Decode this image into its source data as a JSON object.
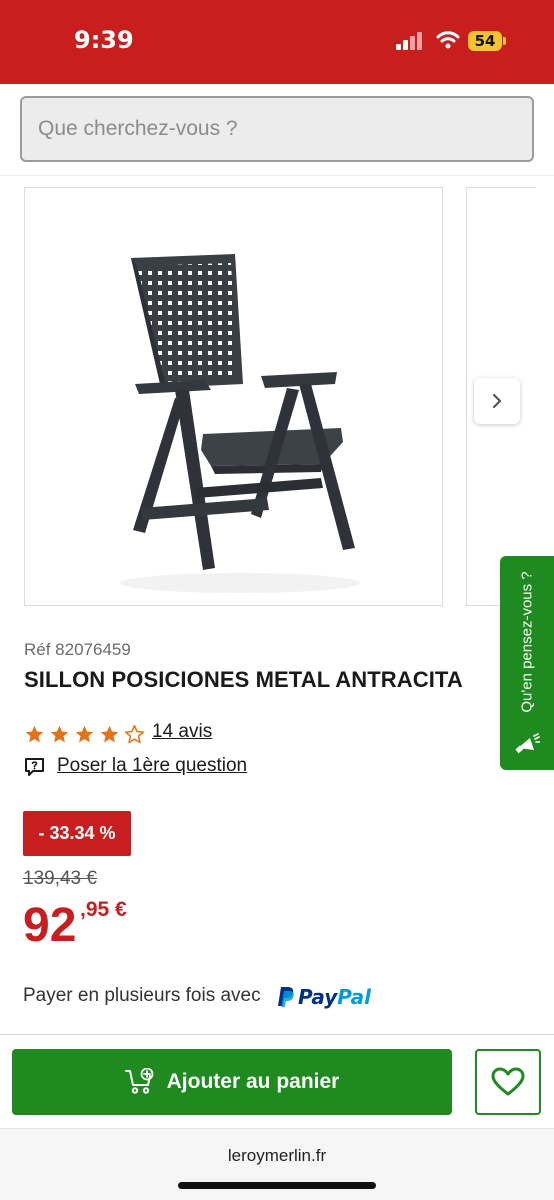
{
  "status_bar": {
    "time": "9:39",
    "battery": "54"
  },
  "search": {
    "placeholder": "Que cherchez-vous ?"
  },
  "product": {
    "ref": "Réf 82076459",
    "title": "SILLON POSICIONES METAL ANTRACITA",
    "rating": 4,
    "rating_max": 5,
    "reviews_label": "14 avis",
    "question_label": "Poser la 1ère question",
    "discount": "- 33.34 %",
    "old_price": "139,43 €",
    "price_int": "92",
    "price_dec": ",95 €",
    "payment_text": "Payer en plusieurs fois avec",
    "paypal_part1": "Pay",
    "paypal_part2": "Pal"
  },
  "feedback": {
    "label": "Qu'en pensez-vous ?"
  },
  "actions": {
    "add_to_cart": "Ajouter au panier"
  },
  "browser": {
    "domain": "leroymerlin.fr"
  },
  "colors": {
    "brand_red": "#c81e1e",
    "green": "#1f8a1f",
    "star_orange": "#e2741a",
    "price_red": "#c71f1f"
  }
}
